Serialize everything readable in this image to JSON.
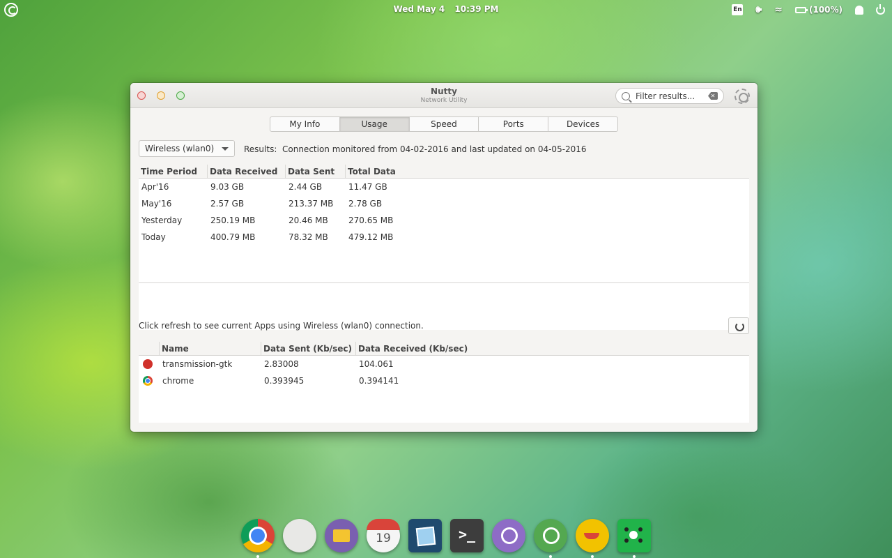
{
  "top_panel": {
    "date": "Wed May  4",
    "time": "10:39 PM",
    "keyboard_layout": "En",
    "battery_text": "(100%)"
  },
  "window": {
    "title": "Nutty",
    "subtitle": "Network Utility",
    "search_placeholder": "Filter results...",
    "tabs": [
      {
        "label": "My Info",
        "active": false
      },
      {
        "label": "Usage",
        "active": true
      },
      {
        "label": "Speed",
        "active": false
      },
      {
        "label": "Ports",
        "active": false
      },
      {
        "label": "Devices",
        "active": false
      }
    ],
    "interface_select": "Wireless (wlan0)",
    "results_label": "Results:",
    "results_text": "Connection monitored from 04-02-2016 and last updated on 04-05-2016",
    "usage_table": {
      "headers": [
        "Time Period",
        "Data Received",
        "Data Sent",
        "Total Data"
      ],
      "rows": [
        [
          "Apr'16",
          "9.03 GB",
          "2.44 GB",
          "11.47 GB"
        ],
        [
          "May'16",
          "2.57 GB",
          "213.37 MB",
          "2.78 GB"
        ],
        [
          "Yesterday",
          "250.19 MB",
          "20.46 MB",
          "270.65 MB"
        ],
        [
          "Today",
          "400.79 MB",
          "78.32 MB",
          "479.12 MB"
        ]
      ]
    },
    "refresh_text": "Click refresh to see current Apps using Wireless (wlan0) connection.",
    "apps_table": {
      "headers": [
        "",
        "Name",
        "Data Sent (Kb/sec)",
        "Data Received (Kb/sec)"
      ],
      "rows": [
        {
          "icon": "transmission-icon",
          "name": "transmission-gtk",
          "sent": "2.83008",
          "received": "104.061"
        },
        {
          "icon": "chrome-icon",
          "name": "chrome",
          "sent": "0.393945",
          "received": "0.394141"
        }
      ]
    }
  },
  "dock": {
    "calendar_day": "19",
    "terminal_glyph": ">_",
    "items": [
      "chrome-icon",
      "switchboard-icon",
      "files-icon",
      "calendar-icon",
      "photos-icon",
      "terminal-icon",
      "viber-icon",
      "whatsapp-icon",
      "lamp-icon",
      "network-icon"
    ]
  }
}
